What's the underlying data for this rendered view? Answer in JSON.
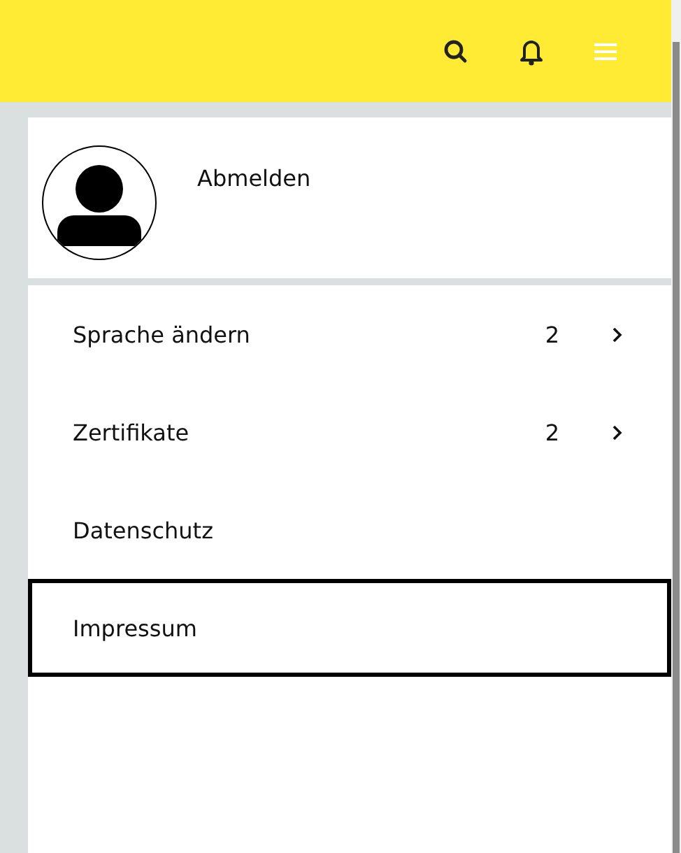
{
  "profile": {
    "action": "Abmelden"
  },
  "menu": [
    {
      "kind": "submenu",
      "label": "Sprache ändern",
      "count": "2",
      "selected": false
    },
    {
      "kind": "submenu",
      "label": "Zertifikate",
      "count": "2",
      "selected": false
    },
    {
      "kind": "link",
      "label": "Datenschutz",
      "selected": false
    },
    {
      "kind": "link",
      "label": "Impressum",
      "selected": true
    }
  ]
}
